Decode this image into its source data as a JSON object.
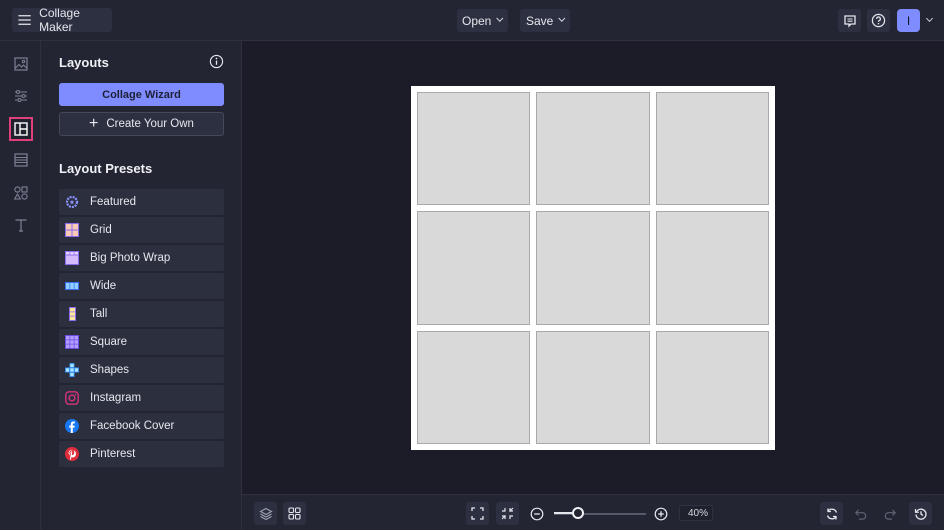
{
  "topbar": {
    "app_title": "Collage Maker",
    "open_label": "Open",
    "save_label": "Save",
    "avatar_initial": "I",
    "icons": [
      "menu-icon",
      "comment-icon",
      "help-icon",
      "chevron-down-icon"
    ]
  },
  "rail": {
    "items": [
      {
        "name": "photos",
        "icon": "image-icon",
        "active": false
      },
      {
        "name": "adjustments",
        "icon": "sliders-icon",
        "active": false
      },
      {
        "name": "layouts",
        "icon": "layout-icon",
        "active": true
      },
      {
        "name": "textures",
        "icon": "texture-icon",
        "active": false
      },
      {
        "name": "graphics",
        "icon": "shapes-icon",
        "active": false
      },
      {
        "name": "text",
        "icon": "text-icon",
        "active": false
      }
    ]
  },
  "panel": {
    "title": "Layouts",
    "wizard_label": "Collage Wizard",
    "create_label": "Create Your Own",
    "presets_title": "Layout Presets",
    "presets": [
      {
        "label": "Featured",
        "icon": "wreath-icon"
      },
      {
        "label": "Grid",
        "icon": "grid-icon"
      },
      {
        "label": "Big Photo Wrap",
        "icon": "big-photo-icon"
      },
      {
        "label": "Wide",
        "icon": "wide-icon"
      },
      {
        "label": "Tall",
        "icon": "tall-icon"
      },
      {
        "label": "Square",
        "icon": "square-grid-icon"
      },
      {
        "label": "Shapes",
        "icon": "shapes-cross-icon"
      },
      {
        "label": "Instagram",
        "icon": "instagram-icon"
      },
      {
        "label": "Facebook Cover",
        "icon": "facebook-icon"
      },
      {
        "label": "Pinterest",
        "icon": "pinterest-icon"
      }
    ]
  },
  "canvas": {
    "rows": 3,
    "cols": 3,
    "cell_color": "#d9d9d9",
    "background": "#ffffff"
  },
  "bottombar": {
    "zoom_percent": 40,
    "zoom_label": "40%",
    "zoom_slider_fraction": 0.26
  },
  "colors": {
    "accent": "#7f8cff",
    "active_highlight": "#e0407a",
    "background": "#1b1c27",
    "panel": "#232532"
  }
}
